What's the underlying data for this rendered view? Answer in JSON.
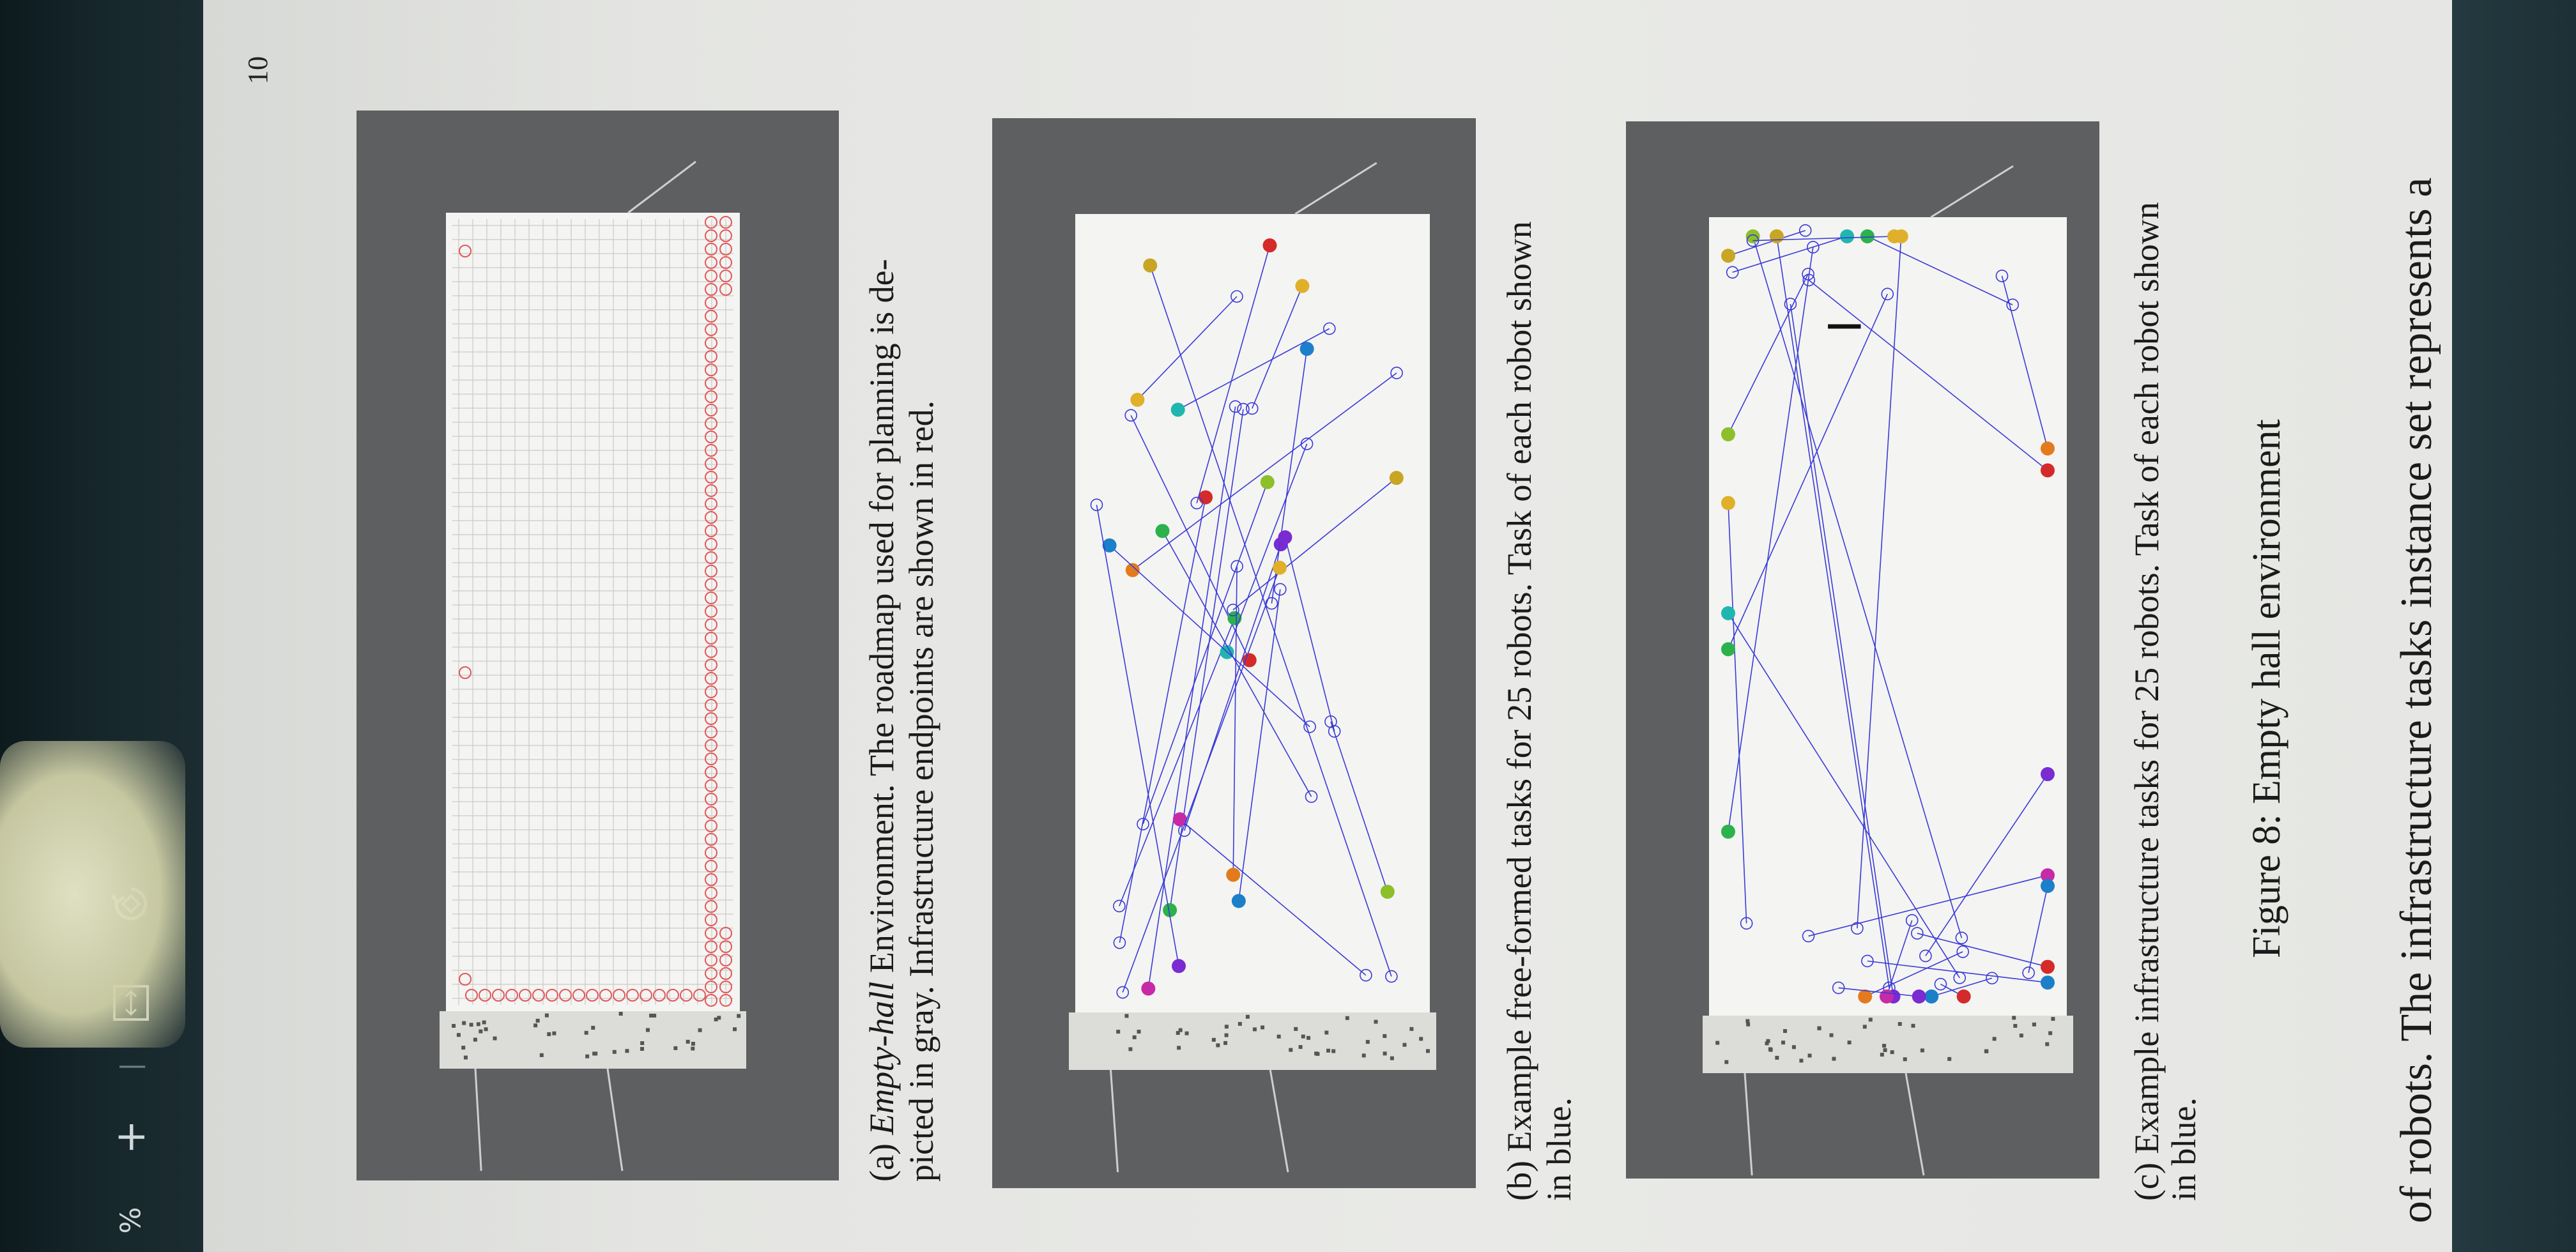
{
  "toolbar": {
    "zoom_label": "%",
    "zoom_in_label": "+",
    "divider": "|"
  },
  "page": {
    "number": "10",
    "caption_a_line1_prefix": "(a) ",
    "caption_a_italic": "Empty-hall",
    "caption_a_line1_rest": " Environment. The roadmap used for planning is de-",
    "caption_a_line2": "picted in gray. Infrastructure endpoints are shown in red.",
    "caption_b_line1": "(b) Example free-formed tasks for 25 robots. Task of each robot shown",
    "caption_b_line2": "in blue.",
    "caption_c_line1": "(c) Example infrastructure tasks for 25 robots. Task of each robot shown",
    "caption_c_line2": "in blue.",
    "figure_title": "Figure 8: Empty hall environment",
    "body_line": "of robots. The infrastructure tasks instance set represents a"
  },
  "colors": {
    "panel": "#5e5f61",
    "hall": "#f4f4f2",
    "roadmap_red": "#e0585a",
    "task_blue": "#3a3ad8"
  }
}
